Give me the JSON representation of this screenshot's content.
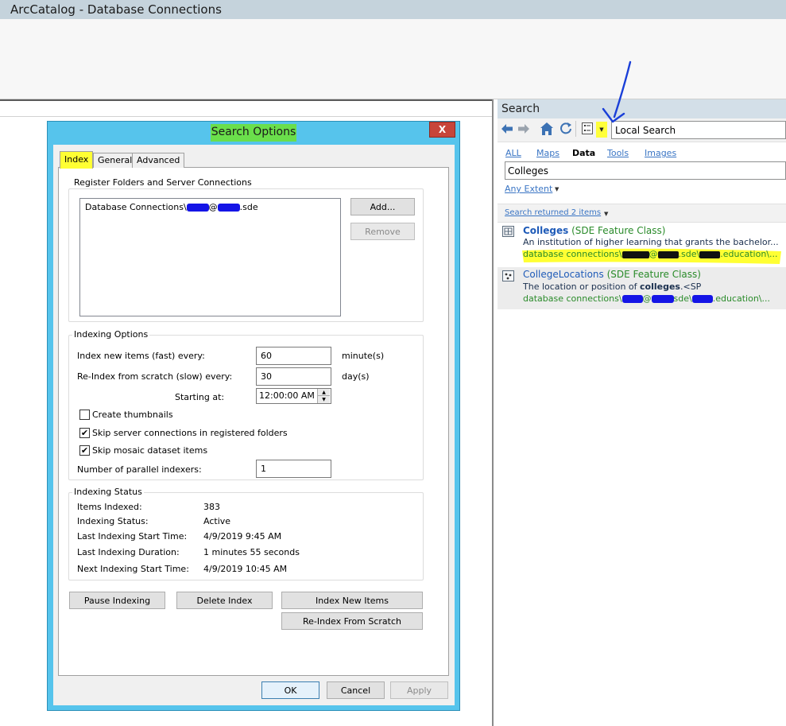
{
  "app": {
    "title": "ArcCatalog - Database Connections"
  },
  "search_pane": {
    "header": "Search",
    "scope": "Local Search",
    "tabs": [
      "ALL",
      "Maps",
      "Data",
      "Tools",
      "Images"
    ],
    "active_tab": "Data",
    "query": "Colleges",
    "extent_label": "Any Extent",
    "results_count": "Search returned 2 items",
    "results": [
      {
        "name": "Colleges",
        "type": "(SDE Feature Class)",
        "description": "An institution of higher learning that grants the bachelor...",
        "path_prefix": "database connections\\",
        "path_mid1": "@",
        "path_mid2": ".sde\\",
        "path_suffix": ".education\\..."
      },
      {
        "name": "CollegeLocations",
        "type": "(SDE Feature Class)",
        "description_prefix": "The location or position of ",
        "description_bold": "colleges",
        "description_suffix": ".<SP",
        "path_prefix": "database connections\\",
        "path_mid1": "@",
        "path_mid2": "sde\\",
        "path_suffix": ".education\\..."
      }
    ]
  },
  "dialog": {
    "title": "Search Options",
    "close": "X",
    "tabs": {
      "index": "Index",
      "general": "General",
      "advanced": "Advanced"
    },
    "register": {
      "label": "Register Folders and Server Connections",
      "item_prefix": "Database Connections\\",
      "item_mid": "@",
      "item_suffix": ".sde",
      "add": "Add...",
      "remove": "Remove"
    },
    "indexing_options": {
      "label": "Indexing Options",
      "new_items_label": "Index new items (fast) every:",
      "new_items_value": "60",
      "new_items_unit": "minute(s)",
      "reindex_label": "Re-Index from scratch (slow) every:",
      "reindex_value": "30",
      "reindex_unit": "day(s)",
      "starting_label": "Starting at:",
      "starting_value": "12:00:00 AM",
      "create_thumbnails": "Create thumbnails",
      "skip_server": "Skip server connections in registered folders",
      "skip_mosaic": "Skip mosaic dataset items",
      "parallel_label": "Number of parallel indexers:",
      "parallel_value": "1",
      "checks": {
        "create_thumbnails": false,
        "skip_server": true,
        "skip_mosaic": true
      }
    },
    "status": {
      "label": "Indexing Status",
      "rows": [
        {
          "key": "Items Indexed:",
          "value": "383"
        },
        {
          "key": "Indexing Status:",
          "value": "Active"
        },
        {
          "key": "Last Indexing Start Time:",
          "value": "4/9/2019 9:45 AM"
        },
        {
          "key": "Last Indexing Duration:",
          "value": "1 minutes 55 seconds"
        },
        {
          "key": "Next Indexing Start Time:",
          "value": "4/9/2019 10:45 AM"
        }
      ]
    },
    "buttons": {
      "pause": "Pause Indexing",
      "delete": "Delete Index",
      "index_new": "Index New Items",
      "reindex": "Re-Index From Scratch",
      "ok": "OK",
      "cancel": "Cancel",
      "apply": "Apply"
    }
  },
  "colors": {
    "dialog_frame": "#56c4ec",
    "title_highlight": "#6adf4b",
    "yellow_highlight": "#ffff33",
    "link_blue": "#3a75c4",
    "path_green": "#2a8b2a",
    "annotation_blue": "#1a3fd8"
  }
}
